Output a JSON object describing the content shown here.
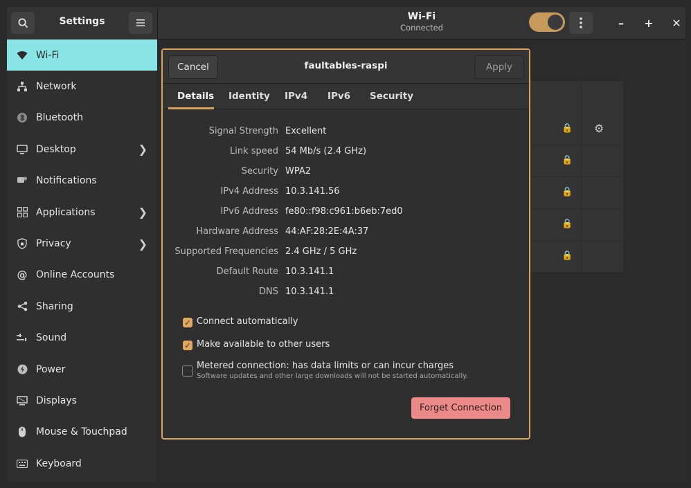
{
  "sidebar_header": {
    "title": "Settings"
  },
  "header": {
    "title": "Wi-Fi",
    "subtitle": "Connected",
    "wifi_enabled": true
  },
  "sidebar": {
    "items": [
      {
        "label": "Wi-Fi",
        "icon": "wifi-icon",
        "active": true,
        "chevron": false
      },
      {
        "label": "Network",
        "icon": "network-icon",
        "chevron": false
      },
      {
        "label": "Bluetooth",
        "icon": "bluetooth-icon",
        "chevron": false
      },
      {
        "label": "Desktop",
        "icon": "desktop-icon",
        "chevron": true
      },
      {
        "label": "Notifications",
        "icon": "notifications-icon",
        "chevron": false
      },
      {
        "label": "Applications",
        "icon": "applications-icon",
        "chevron": true
      },
      {
        "label": "Privacy",
        "icon": "privacy-icon",
        "chevron": true
      },
      {
        "label": "Online Accounts",
        "icon": "online-accounts-icon",
        "chevron": false
      },
      {
        "label": "Sharing",
        "icon": "sharing-icon",
        "chevron": false
      },
      {
        "label": "Sound",
        "icon": "sound-icon",
        "chevron": false
      },
      {
        "label": "Power",
        "icon": "power-icon",
        "chevron": false
      },
      {
        "label": "Displays",
        "icon": "displays-icon",
        "chevron": false
      },
      {
        "label": "Mouse & Touchpad",
        "icon": "mouse-icon",
        "chevron": false
      },
      {
        "label": "Keyboard",
        "icon": "keyboard-icon",
        "chevron": false
      }
    ]
  },
  "dialog": {
    "cancel_label": "Cancel",
    "title": "faultables-raspi",
    "apply_label": "Apply",
    "tabs": [
      "Details",
      "Identity",
      "IPv4",
      "IPv6",
      "Security"
    ],
    "active_tab": "Details",
    "details": [
      {
        "key": "Signal Strength",
        "value": "Excellent"
      },
      {
        "key": "Link speed",
        "value": "54 Mb/s (2.4 GHz)"
      },
      {
        "key": "Security",
        "value": "WPA2"
      },
      {
        "key": "IPv4 Address",
        "value": "10.3.141.56"
      },
      {
        "key": "IPv6 Address",
        "value": "fe80::f98:c961:b6eb:7ed0"
      },
      {
        "key": "Hardware Address",
        "value": "44:AF:28:2E:4A:37"
      },
      {
        "key": "Supported Frequencies",
        "value": "2.4 GHz / 5 GHz"
      },
      {
        "key": "Default Route",
        "value": "10.3.141.1"
      },
      {
        "key": "DNS",
        "value": "10.3.141.1"
      }
    ],
    "checks": {
      "connect_auto": {
        "label": "Connect automatically",
        "checked": true
      },
      "available_others": {
        "label": "Make available to other users",
        "checked": true
      },
      "metered": {
        "label": "Metered connection: has data limits or can incur charges",
        "sublabel": "Software updates and other large downloads will not be started automatically.",
        "checked": false
      }
    },
    "forget_label": "Forget Connection"
  },
  "colors": {
    "accent": "#d9a35c",
    "selection": "#89e5e5",
    "danger": "#eb8a88"
  }
}
